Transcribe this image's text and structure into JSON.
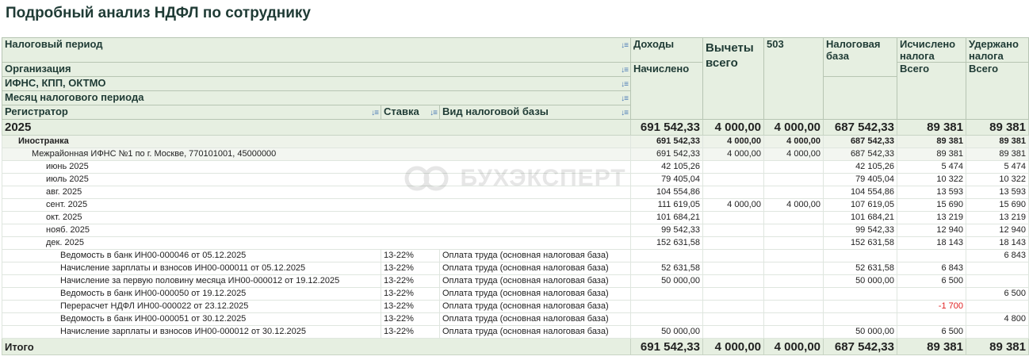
{
  "title": "Подробный анализ НДФЛ по сотруднику",
  "watermark": "БУХЭКСПЕРТ",
  "headers": {
    "row_fields": {
      "period": "Налоговый период",
      "org": "Организация",
      "ifns": "ИФНС, КПП, ОКТМО",
      "month": "Месяц налогового периода",
      "registrar": "Регистратор",
      "rate": "Ставка",
      "base_type": "Вид налоговой базы"
    },
    "columns": {
      "income": "Доходы",
      "income_sub": "Начислено",
      "deductions": "Вычеты всего",
      "code503": "503",
      "tax_base": "Налоговая база",
      "calculated": "Исчислено налога",
      "calculated_sub": "Всего",
      "withheld": "Удержано налога",
      "withheld_sub": "Всего"
    }
  },
  "rows": [
    {
      "type": "year",
      "label": "2025",
      "rate": "",
      "base": "",
      "income": "691 542,33",
      "deductions": "4 000,00",
      "code503": "4 000,00",
      "tax_base": "687 542,33",
      "calculated": "89 381",
      "withheld": "89 381"
    },
    {
      "type": "org",
      "label": "Иностранка",
      "rate": "",
      "base": "",
      "income": "691 542,33",
      "deductions": "4 000,00",
      "code503": "4 000,00",
      "tax_base": "687 542,33",
      "calculated": "89 381",
      "withheld": "89 381"
    },
    {
      "type": "ifns",
      "label": "Межрайонная ИФНС №1 по г. Москве, 770101001, 45000000",
      "rate": "",
      "base": "",
      "income": "691 542,33",
      "deductions": "4 000,00",
      "code503": "4 000,00",
      "tax_base": "687 542,33",
      "calculated": "89 381",
      "withheld": "89 381"
    },
    {
      "type": "month",
      "label": "июнь 2025",
      "rate": "",
      "base": "",
      "income": "42 105,26",
      "deductions": "",
      "code503": "",
      "tax_base": "42 105,26",
      "calculated": "5 474",
      "withheld": "5 474"
    },
    {
      "type": "month",
      "label": "июль 2025",
      "rate": "",
      "base": "",
      "income": "79 405,04",
      "deductions": "",
      "code503": "",
      "tax_base": "79 405,04",
      "calculated": "10 322",
      "withheld": "10 322"
    },
    {
      "type": "month",
      "label": "авг. 2025",
      "rate": "",
      "base": "",
      "income": "104 554,86",
      "deductions": "",
      "code503": "",
      "tax_base": "104 554,86",
      "calculated": "13 593",
      "withheld": "13 593"
    },
    {
      "type": "month",
      "label": "сент. 2025",
      "rate": "",
      "base": "",
      "income": "111 619,05",
      "deductions": "4 000,00",
      "code503": "4 000,00",
      "tax_base": "107 619,05",
      "calculated": "15 690",
      "withheld": "15 690"
    },
    {
      "type": "month",
      "label": "окт. 2025",
      "rate": "",
      "base": "",
      "income": "101 684,21",
      "deductions": "",
      "code503": "",
      "tax_base": "101 684,21",
      "calculated": "13 219",
      "withheld": "13 219"
    },
    {
      "type": "month",
      "label": "нояб. 2025",
      "rate": "",
      "base": "",
      "income": "99 542,33",
      "deductions": "",
      "code503": "",
      "tax_base": "99 542,33",
      "calculated": "12 940",
      "withheld": "12 940"
    },
    {
      "type": "month",
      "label": "дек. 2025",
      "rate": "",
      "base": "",
      "income": "152 631,58",
      "deductions": "",
      "code503": "",
      "tax_base": "152 631,58",
      "calculated": "18 143",
      "withheld": "18 143"
    },
    {
      "type": "doc",
      "label": "Ведомость в банк ИН00-000046 от 05.12.2025",
      "rate": "13-22%",
      "base": "Оплата труда (основная налоговая база)",
      "income": "",
      "deductions": "",
      "code503": "",
      "tax_base": "",
      "calculated": "",
      "withheld": "6 843"
    },
    {
      "type": "doc",
      "label": "Начисление зарплаты и взносов ИН00-000011 от 05.12.2025",
      "rate": "13-22%",
      "base": "Оплата труда (основная налоговая база)",
      "income": "52 631,58",
      "deductions": "",
      "code503": "",
      "tax_base": "52 631,58",
      "calculated": "6 843",
      "withheld": ""
    },
    {
      "type": "doc",
      "label": "Начисление за первую половину месяца ИН00-000012 от 19.12.2025",
      "rate": "13-22%",
      "base": "Оплата труда (основная налоговая база)",
      "income": "50 000,00",
      "deductions": "",
      "code503": "",
      "tax_base": "50 000,00",
      "calculated": "6 500",
      "withheld": ""
    },
    {
      "type": "doc",
      "label": "Ведомость в банк ИН00-000050 от 19.12.2025",
      "rate": "13-22%",
      "base": "Оплата труда (основная налоговая база)",
      "income": "",
      "deductions": "",
      "code503": "",
      "tax_base": "",
      "calculated": "",
      "withheld": "6 500"
    },
    {
      "type": "doc",
      "label": "Перерасчет НДФЛ ИН00-000022 от 23.12.2025",
      "rate": "13-22%",
      "base": "Оплата труда (основная налоговая база)",
      "income": "",
      "deductions": "",
      "code503": "",
      "tax_base": "",
      "calculated": "-1 700",
      "withheld": ""
    },
    {
      "type": "doc",
      "label": "Ведомость в банк ИН00-000051 от 30.12.2025",
      "rate": "13-22%",
      "base": "Оплата труда (основная налоговая база)",
      "income": "",
      "deductions": "",
      "code503": "",
      "tax_base": "",
      "calculated": "",
      "withheld": "4 800"
    },
    {
      "type": "doc",
      "label": "Начисление зарплаты и взносов ИН00-000012 от 30.12.2025",
      "rate": "13-22%",
      "base": "Оплата труда (основная налоговая база)",
      "income": "50 000,00",
      "deductions": "",
      "code503": "",
      "tax_base": "50 000,00",
      "calculated": "6 500",
      "withheld": ""
    }
  ],
  "total": {
    "label": "Итого",
    "income": "691 542,33",
    "deductions": "4 000,00",
    "code503": "4 000,00",
    "tax_base": "687 542,33",
    "calculated": "89 381",
    "withheld": "89 381"
  },
  "colors": {
    "header_bg": "#e6efe1",
    "title": "#1f3b35",
    "negative": "#e02020",
    "sort_icon": "#4a7ab5"
  },
  "icons": {
    "sort": "sort-icon"
  }
}
